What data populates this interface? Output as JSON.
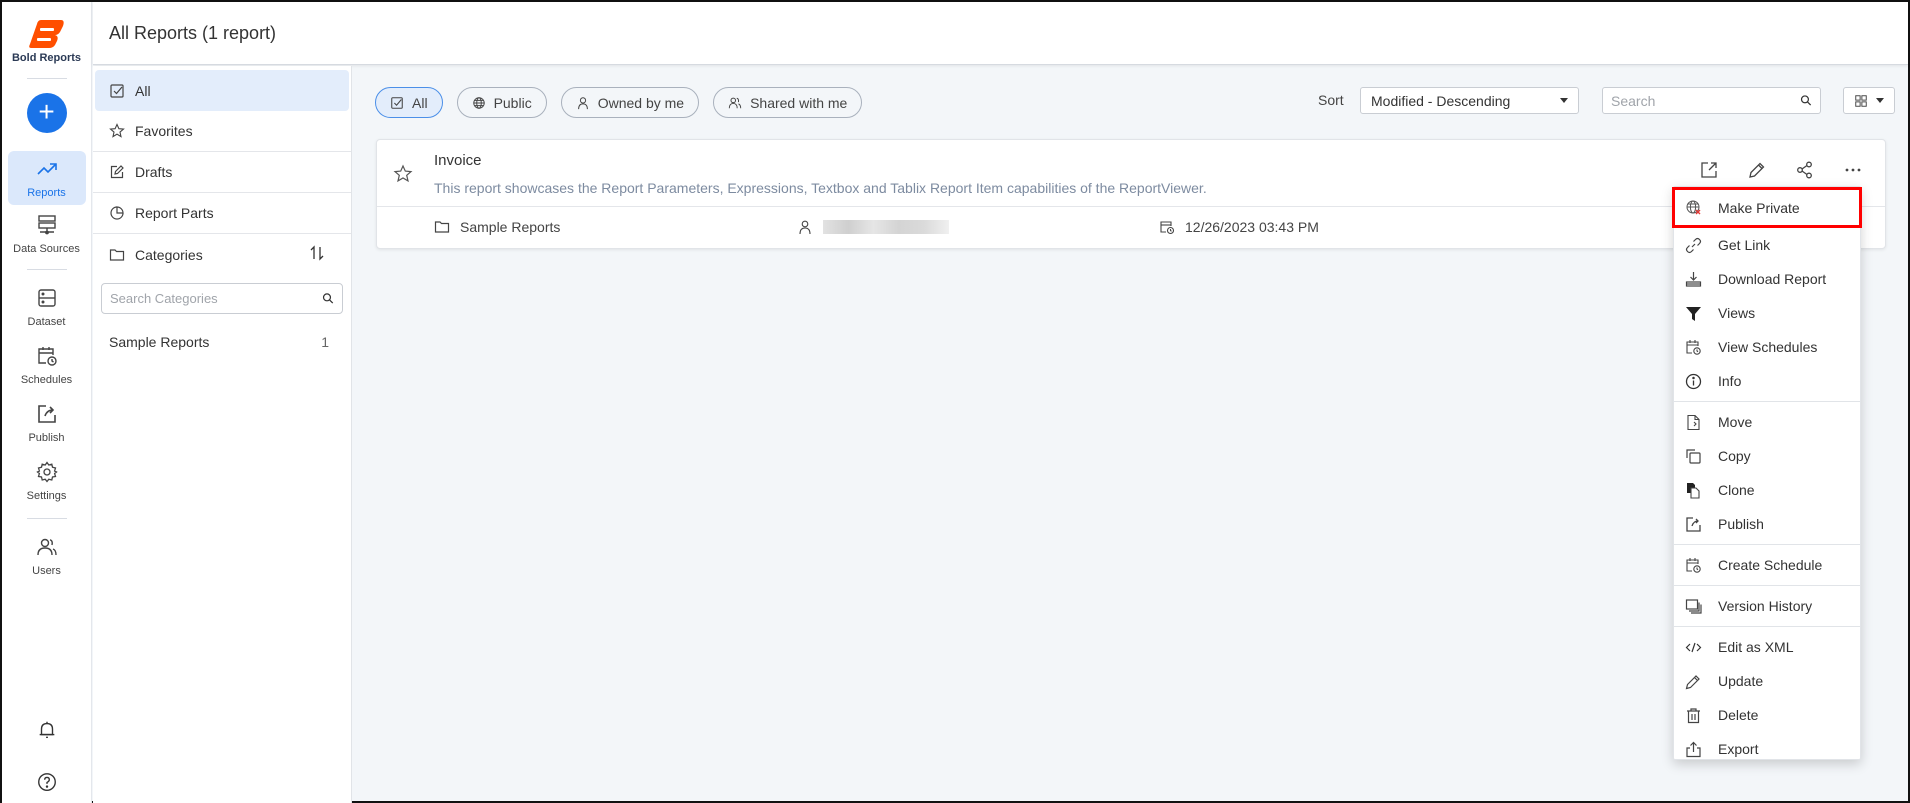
{
  "app": {
    "brand": "Bold Reports",
    "brand_color": "#ff4f00",
    "accent_color": "#1a73e8",
    "highlight_color": "#ff0000"
  },
  "rail": {
    "create_label": "+",
    "items": [
      {
        "label": "Reports",
        "icon": "trend-icon",
        "active": true
      },
      {
        "label": "Data Sources",
        "icon": "server-icon",
        "active": false
      },
      {
        "label": "Dataset",
        "icon": "dataset-icon",
        "active": false
      },
      {
        "label": "Schedules",
        "icon": "calendar-clock-icon",
        "active": false
      },
      {
        "label": "Publish",
        "icon": "publish-icon",
        "active": false
      },
      {
        "label": "Settings",
        "icon": "gear-icon",
        "active": false
      },
      {
        "label": "Users",
        "icon": "users-icon",
        "active": false
      }
    ],
    "bottom": [
      {
        "icon": "bell-icon"
      },
      {
        "icon": "help-icon"
      }
    ]
  },
  "header": {
    "title": "All Reports (1 report)"
  },
  "side": {
    "items": [
      {
        "label": "All",
        "icon": "checkbox-icon",
        "active": true
      },
      {
        "label": "Favorites",
        "icon": "star-icon"
      },
      {
        "label": "Drafts",
        "icon": "edit-icon"
      },
      {
        "label": "Report Parts",
        "icon": "pie-icon"
      },
      {
        "label": "Categories",
        "icon": "folder-icon"
      }
    ],
    "category_search_placeholder": "Search Categories",
    "categories": [
      {
        "name": "Sample Reports",
        "count": "1"
      }
    ]
  },
  "toolbar": {
    "filters": [
      {
        "label": "All",
        "icon": "checkbox-icon",
        "active": true
      },
      {
        "label": "Public",
        "icon": "globe-icon",
        "active": false
      },
      {
        "label": "Owned by me",
        "icon": "user-icon",
        "active": false
      },
      {
        "label": "Shared with me",
        "icon": "users-icon",
        "active": false
      }
    ],
    "sort_label": "Sort",
    "sort_value": "Modified - Descending",
    "search_placeholder": "Search",
    "view_icon": "grid-icon"
  },
  "reports": [
    {
      "name": "Invoice",
      "description": "This report showcases the Report Parameters, Expressions, Textbox and Tablix Report Item capabilities of the ReportViewer.",
      "category": "Sample Reports",
      "owner": "",
      "modified": "12/26/2023 03:43 PM",
      "favorite": false
    }
  ],
  "context_menu": {
    "groups": [
      [
        {
          "label": "Make Private",
          "icon": "globe-x-icon",
          "highlighted": true
        },
        {
          "label": "Get Link",
          "icon": "link-icon"
        },
        {
          "label": "Download Report",
          "icon": "download-icon"
        },
        {
          "label": "Views",
          "icon": "filter-icon"
        },
        {
          "label": "View Schedules",
          "icon": "calendar-clock-icon"
        },
        {
          "label": "Info",
          "icon": "info-icon"
        }
      ],
      [
        {
          "label": "Move",
          "icon": "move-icon"
        },
        {
          "label": "Copy",
          "icon": "copy-icon"
        },
        {
          "label": "Clone",
          "icon": "clone-icon"
        },
        {
          "label": "Publish",
          "icon": "publish-icon"
        }
      ],
      [
        {
          "label": "Create Schedule",
          "icon": "calendar-clock-icon"
        }
      ],
      [
        {
          "label": "Version History",
          "icon": "version-icon"
        }
      ],
      [
        {
          "label": "Edit as XML",
          "icon": "code-icon"
        },
        {
          "label": "Update",
          "icon": "pencil-icon"
        },
        {
          "label": "Delete",
          "icon": "trash-icon"
        },
        {
          "label": "Export",
          "icon": "export-icon"
        }
      ]
    ]
  }
}
